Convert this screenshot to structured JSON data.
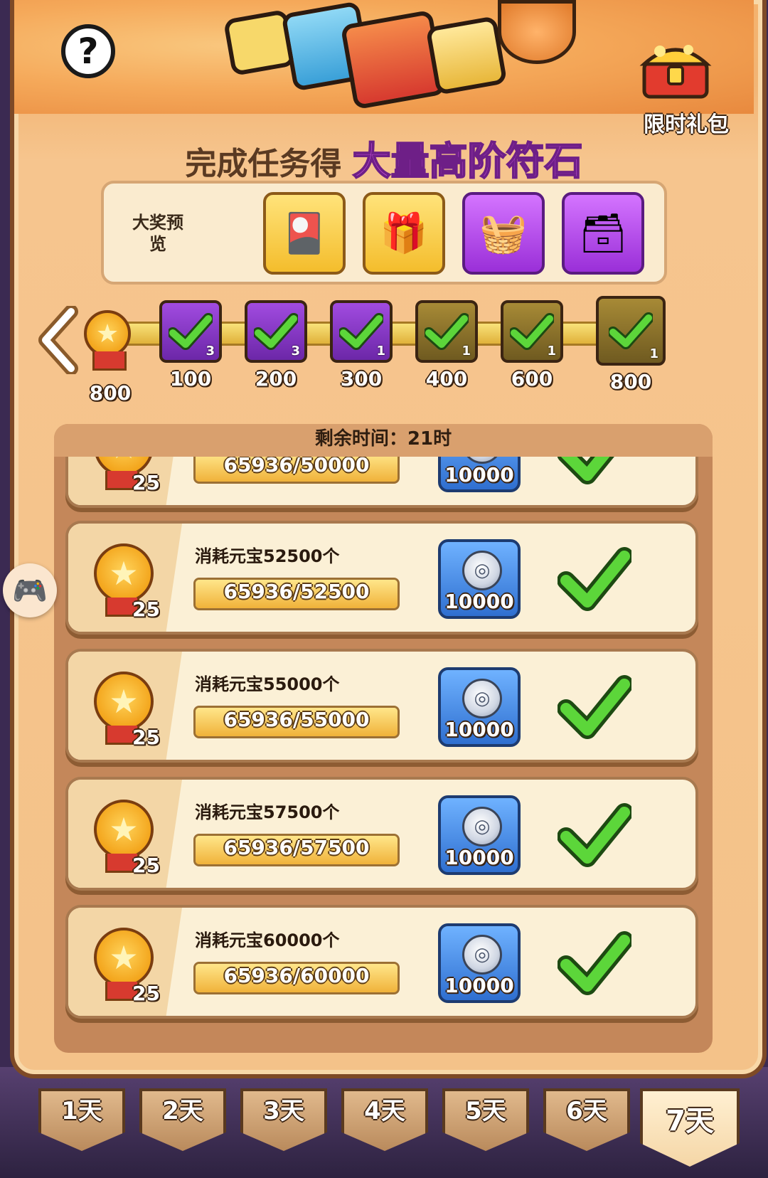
{
  "header": {
    "help_glyph": "?",
    "gift_label": "限时礼包",
    "title_prefix": "完成任务得",
    "title_highlight": "大量高阶符石"
  },
  "preview": {
    "label": "大奖预览",
    "prizes": [
      {
        "icon": "gold-cards-basket-icon",
        "bg": "gold"
      },
      {
        "icon": "gold-cards-bundle-icon",
        "bg": "gold"
      },
      {
        "icon": "purple-cards-basket-icon",
        "bg": "purple"
      },
      {
        "icon": "purple-cards-chest-icon",
        "bg": "purple"
      }
    ]
  },
  "progress": {
    "current_points": "800",
    "milestones": [
      {
        "points": "100",
        "count": "3",
        "bg": "purple",
        "claimed": true
      },
      {
        "points": "200",
        "count": "3",
        "bg": "purple",
        "claimed": true
      },
      {
        "points": "300",
        "count": "1",
        "bg": "purple",
        "claimed": true
      },
      {
        "points": "400",
        "count": "1",
        "bg": "olive",
        "claimed": true
      },
      {
        "points": "600",
        "count": "1",
        "bg": "olive",
        "claimed": true
      },
      {
        "points": "800",
        "count": "1",
        "bg": "olive",
        "claimed": true
      }
    ]
  },
  "tasks": {
    "time_label": "剩余时间：21时",
    "items": [
      {
        "desc": "",
        "medal_points": "25",
        "progress": "65936/50000",
        "reward": "10000",
        "done": true
      },
      {
        "desc": "消耗元宝52500个",
        "medal_points": "25",
        "progress": "65936/52500",
        "reward": "10000",
        "done": true
      },
      {
        "desc": "消耗元宝55000个",
        "medal_points": "25",
        "progress": "65936/55000",
        "reward": "10000",
        "done": true
      },
      {
        "desc": "消耗元宝57500个",
        "medal_points": "25",
        "progress": "65936/57500",
        "reward": "10000",
        "done": true
      },
      {
        "desc": "消耗元宝60000个",
        "medal_points": "25",
        "progress": "65936/60000",
        "reward": "10000",
        "done": true
      }
    ]
  },
  "tabs": [
    {
      "label": "1天",
      "active": false
    },
    {
      "label": "2天",
      "active": false
    },
    {
      "label": "3天",
      "active": false
    },
    {
      "label": "4天",
      "active": false
    },
    {
      "label": "5天",
      "active": false
    },
    {
      "label": "6天",
      "active": false
    },
    {
      "label": "7天",
      "active": true
    }
  ],
  "colors": {
    "accent_purple": "#c34fd6",
    "check_green": "#5cd63a",
    "reward_blue": "#2f6fd0"
  }
}
